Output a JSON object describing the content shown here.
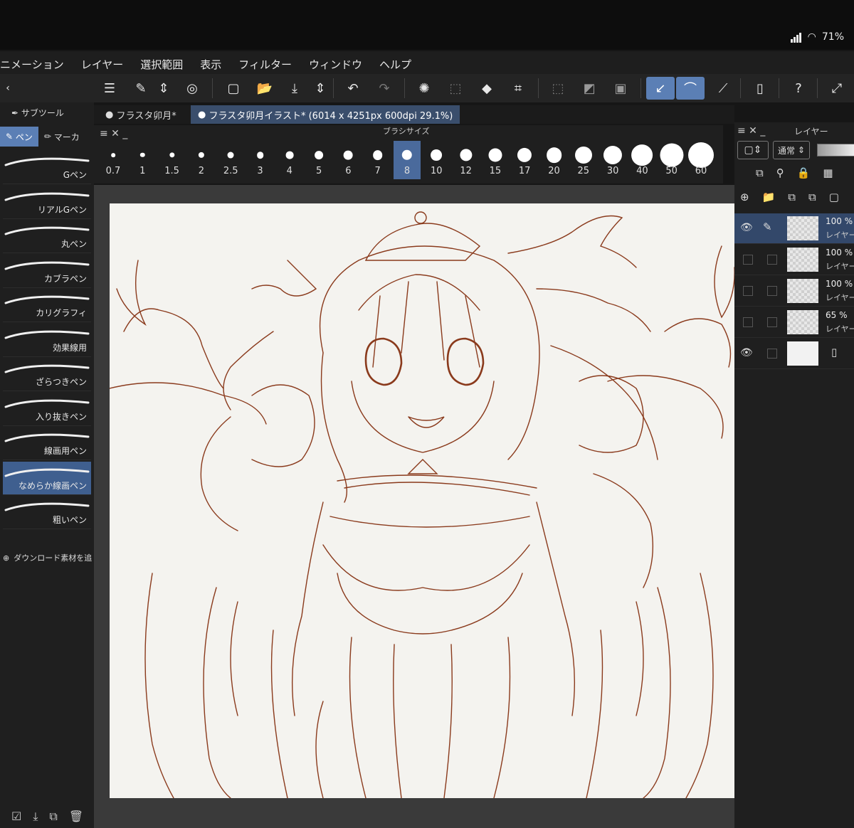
{
  "status": {
    "battery": "71%"
  },
  "menu": [
    "ニメーション",
    "レイヤー",
    "選択範囲",
    "表示",
    "フィルター",
    "ウィンドウ",
    "ヘルプ"
  ],
  "left_panel": {
    "subtool_tab": "サブツール",
    "categories": [
      "ペン",
      "マーカ"
    ],
    "brushes": [
      "Gペン",
      "リアルGペン",
      "丸ペン",
      "カブラペン",
      "カリグラフィ",
      "効果線用",
      "ざらつきペン",
      "入り抜きペン",
      "線画用ペン",
      "なめらか線画ペン",
      "粗いペン"
    ],
    "active_brush_index": 9,
    "download_label": "ダウンロード素材を追"
  },
  "doc_tabs": [
    "フラスタ卯月*",
    "フラスタ卯月イラスト* (6014 x 4251px 600dpi 29.1%)"
  ],
  "brush_size_panel": {
    "title": "ブラシサイズ",
    "sizes": [
      "0.7",
      "1",
      "1.5",
      "2",
      "2.5",
      "3",
      "4",
      "5",
      "6",
      "7",
      "8",
      "10",
      "12",
      "15",
      "17",
      "20",
      "25",
      "30",
      "40",
      "50",
      "60"
    ],
    "active_index": 10
  },
  "layer_panel": {
    "title": "レイヤー",
    "blend_mode": "通常",
    "layers": [
      {
        "opacity": "100 %",
        "name": "レイヤー"
      },
      {
        "opacity": "100 %",
        "name": "レイヤー"
      },
      {
        "opacity": "100 %",
        "name": "レイヤー"
      },
      {
        "opacity": "65 %",
        "name": "レイヤー"
      },
      {
        "opacity": "",
        "name": ""
      }
    ]
  },
  "colors": {
    "accent": "#5b7fb5",
    "line_art": "#8a3a1c",
    "paper": "#f4f3ef"
  }
}
